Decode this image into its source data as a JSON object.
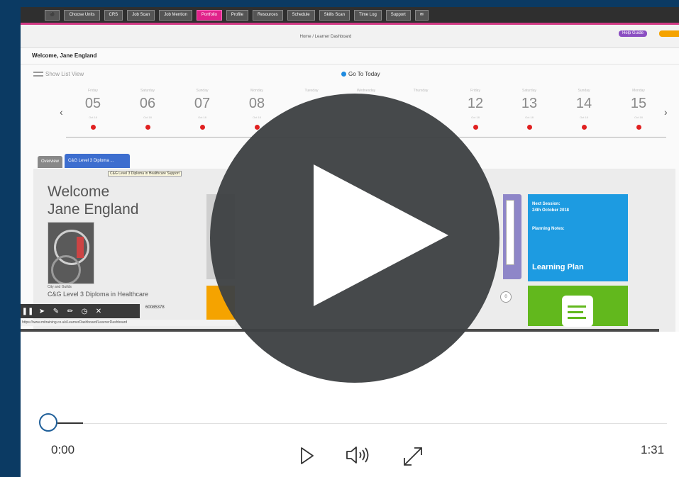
{
  "video_frame": {
    "navbar": {
      "items": [
        "Choose Units",
        "CRS",
        "Job Scan",
        "Job Mention",
        "Portfolio",
        "Profile",
        "Resources",
        "Schedule",
        "Skills Scan",
        "Time Log",
        "Support"
      ],
      "active": "Portfolio"
    },
    "breadcrumb": "Home / Learner Dashboard",
    "help_guide": "Help Guide",
    "welcome_line": "Welcome, Jane England",
    "show_list_view": "Show List View",
    "go_to_today": "Go To Today",
    "days": [
      {
        "name": "Friday",
        "num": "05",
        "month": "Oct 18"
      },
      {
        "name": "Saturday",
        "num": "06",
        "month": "Oct 18"
      },
      {
        "name": "Sunday",
        "num": "07",
        "month": "Oct 18"
      },
      {
        "name": "Monday",
        "num": "08",
        "month": "Oct 18"
      },
      {
        "name": "Tuesday",
        "num": "",
        "month": ""
      },
      {
        "name": "Wednesday",
        "num": "",
        "month": ""
      },
      {
        "name": "Thursday",
        "num": "",
        "month": ""
      },
      {
        "name": "Friday",
        "num": "12",
        "month": "Oct 18"
      },
      {
        "name": "Saturday",
        "num": "13",
        "month": "Oct 18"
      },
      {
        "name": "Sunday",
        "num": "14",
        "month": "Oct 18"
      },
      {
        "name": "Monday",
        "num": "15",
        "month": "Oct 18"
      }
    ],
    "tabs": [
      "Overview",
      "C&G Level 3 Diploma ..."
    ],
    "tooltip": "C&G Level 3 Diploma in Healthcare Support",
    "welcome_title_1": "Welcome",
    "welcome_title_2": "Jane England",
    "awarding_body": "City and Guilds",
    "course_name": "C&G Level 3 Diploma in Healthcare",
    "part_number": "60085378",
    "url": "https://www.mitraining.co.uk/LearnerDashboard/LearnerDashboard",
    "next_session_label": "Next Session:",
    "next_session_date": "24th October 2018",
    "planning_notes": "Planning Notes:",
    "learning_plan": "Learning Plan",
    "badge_count": "0"
  },
  "player": {
    "current_time": "0:00",
    "total_time": "1:31",
    "progress": 0,
    "icons": [
      "play-icon",
      "volume-icon",
      "fullscreen-icon",
      "big-play-icon"
    ],
    "colors": {
      "page_bg": "#0b3a63",
      "knob": "#1f5f99",
      "overlay": "#3e4244"
    }
  }
}
